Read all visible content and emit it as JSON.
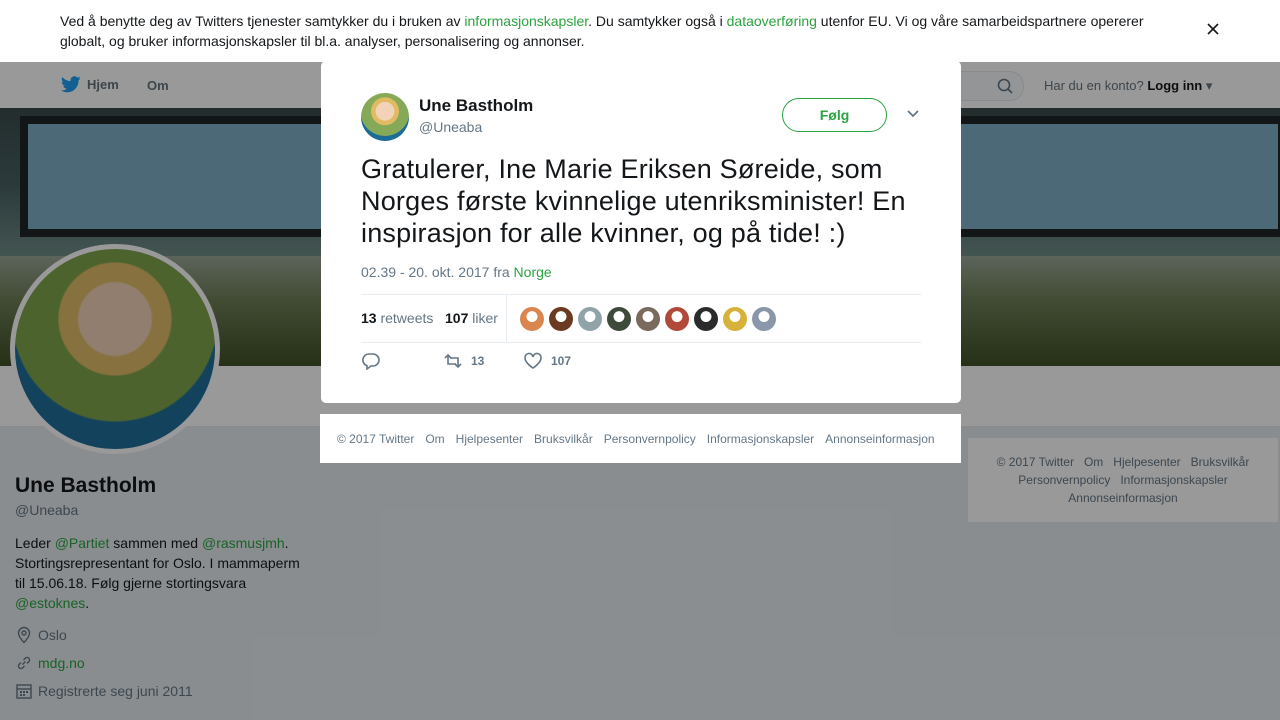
{
  "cookie": {
    "text_before": "Ved å benytte deg av Twitters tjenester samtykker du i bruken av ",
    "link1": "informasjonskapsler",
    "text_mid": ". Du samtykker også i ",
    "link2": "dataoverføring",
    "text_after": " utenfor EU. Vi og våre samarbeidspartnere opererer globalt, og bruker informasjonskapsler til bl.a. analyser, personalisering og annonser."
  },
  "nav": {
    "home": "Hjem",
    "about": "Om",
    "login_prompt": "Har du en konto?",
    "login_link": "Logg inn"
  },
  "profile": {
    "name": "Une Bastholm",
    "handle": "@Uneaba",
    "bio_1": "Leder ",
    "bio_link1": "@Partiet",
    "bio_2": " sammen med ",
    "bio_link2": "@rasmusjmh",
    "bio_3": ". Stortingsrepresentant for Oslo. I mammaperm til 15.06.18. Følg gjerne stortingsvara ",
    "bio_link3": "@estoknes",
    "bio_4": ".",
    "location": "Oslo",
    "website": "mdg.no",
    "joined": "Registrerte seg juni 2011"
  },
  "tweet": {
    "author_name": "Une Bastholm",
    "author_handle": "@Uneaba",
    "follow_label": "Følg",
    "text": "Gratulerer, Ine Marie Eriksen Søreide, som Norges første kvinnelige utenriksminister! En inspirasjon for alle kvinner, og på tide! :)",
    "time": "02.39 - 20. okt. 2017 fra ",
    "place": "Norge",
    "retweets_count": "13",
    "retweets_label": "retweets",
    "likes_count": "107",
    "likes_label": "liker",
    "action_retweets": "13",
    "action_likes": "107",
    "liker_colors": [
      "#d9874f",
      "#6b3a20",
      "#8fa3a8",
      "#3e4a3a",
      "#7a6a5d",
      "#b24a3a",
      "#2b2b2b",
      "#d6b23a",
      "#8a97a8"
    ]
  },
  "footer_links": [
    "© 2017 Twitter",
    "Om",
    "Hjelpesenter",
    "Bruksvilkår",
    "Personvernpolicy",
    "Informasjonskapsler",
    "Annonseinformasjon"
  ],
  "colors": {
    "accent": "#2ba340",
    "twitter_blue": "#1da1f2"
  }
}
